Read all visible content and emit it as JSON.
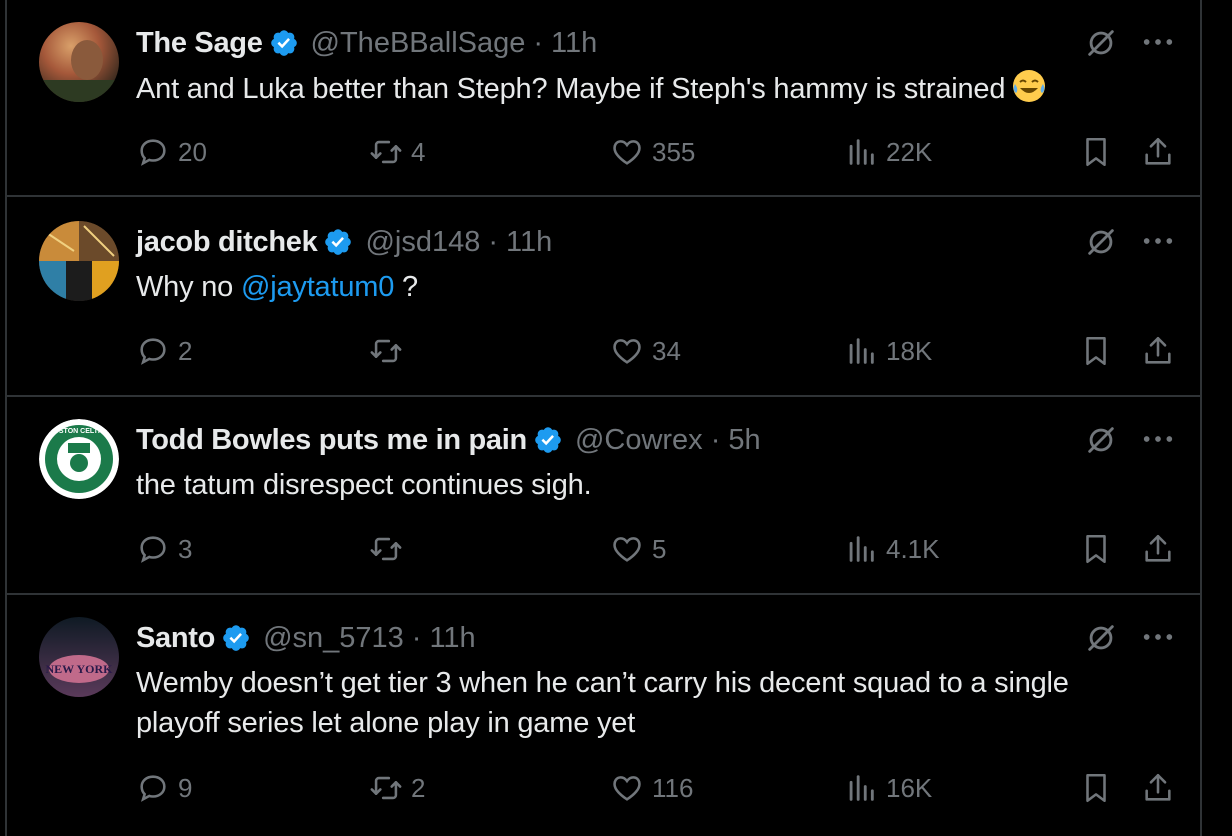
{
  "posts": [
    {
      "name": "The Sage",
      "handle": "@TheBBallSage",
      "time": "11h",
      "text": "Ant and Luka better than Steph? Maybe if Steph's hammy is strained",
      "emoji": "face-with-tears-of-joy",
      "replies": "20",
      "reposts": "4",
      "likes": "355",
      "views": "22K"
    },
    {
      "name": "jacob ditchek",
      "handle": "@jsd148",
      "time": "11h",
      "text_before": "Why no ",
      "mention": "@jaytatum0",
      "text_after": " ?",
      "replies": "2",
      "reposts": "",
      "likes": "34",
      "views": "18K"
    },
    {
      "name": "Todd Bowles puts me in pain",
      "handle": "@Cowrex",
      "time": "5h",
      "text": "the tatum disrespect continues sigh.",
      "avatar_text": "BOSTON CELTICS",
      "replies": "3",
      "reposts": "",
      "likes": "5",
      "views": "4.1K"
    },
    {
      "name": "Santo",
      "handle": "@sn_5713",
      "time": "11h",
      "text": "Wemby doesn’t get tier 3 when he can’t carry his decent squad to a single playoff series let alone play in game yet",
      "avatar_text": "NEW YORK",
      "replies": "9",
      "reposts": "2",
      "likes": "116",
      "views": "16K"
    }
  ],
  "separator": "·",
  "colors": {
    "background": "#000000",
    "text": "#e7e9ea",
    "muted": "#71767b",
    "link": "#1d9bf0",
    "border": "#2f3336",
    "verified": "#1d9bf0"
  },
  "icons": [
    "verified-badge-icon",
    "grok-icon",
    "more-icon",
    "reply-icon",
    "repost-icon",
    "like-icon",
    "views-icon",
    "bookmark-icon",
    "share-icon"
  ]
}
